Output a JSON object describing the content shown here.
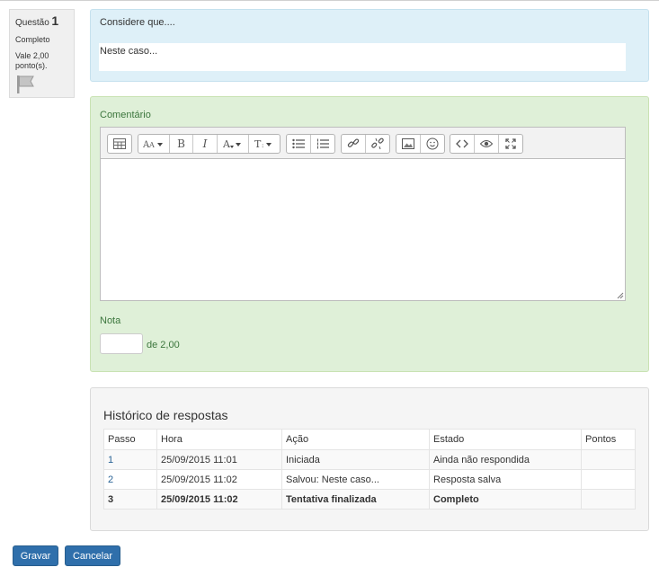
{
  "question_info": {
    "label": "Questão",
    "number": "1",
    "state": "Completo",
    "grade": "Vale 2,00 ponto(s)."
  },
  "formulation": {
    "question_text": "Considere que....",
    "answer_text": "Neste caso..."
  },
  "comment": {
    "label": "Comentário",
    "toolbar_icons": [
      "table-icon",
      "font-family-icon",
      "bold-icon",
      "italic-icon",
      "font-color-icon",
      "font-size-icon",
      "unordered-list-icon",
      "ordered-list-icon",
      "link-icon",
      "unlink-icon",
      "image-icon",
      "emoticon-icon",
      "html-source-icon",
      "preview-icon",
      "fullscreen-icon"
    ],
    "bold_glyph": "B",
    "italic_glyph": "I",
    "editor_value": ""
  },
  "grade": {
    "label": "Nota",
    "value": "",
    "max_label": "de 2,00"
  },
  "history": {
    "title": "Histórico de respostas",
    "columns": [
      "Passo",
      "Hora",
      "Ação",
      "Estado",
      "Pontos"
    ],
    "rows": [
      {
        "step": "1",
        "time": "25/09/2015 11:01",
        "action": "Iniciada",
        "state": "Ainda não respondida",
        "marks": ""
      },
      {
        "step": "2",
        "time": "25/09/2015 11:02",
        "action": "Salvou: Neste caso...",
        "state": "Resposta salva",
        "marks": ""
      },
      {
        "step": "3",
        "time": "25/09/2015 11:02",
        "action": "Tentativa finalizada",
        "state": "Completo",
        "marks": ""
      }
    ]
  },
  "buttons": {
    "save": "Gravar",
    "cancel": "Cancelar"
  },
  "colors": {
    "formulation_bg": "#def0f8",
    "comment_bg": "#dff0d8",
    "button_primary": "#2f6fab",
    "label_green": "#3c763d"
  }
}
